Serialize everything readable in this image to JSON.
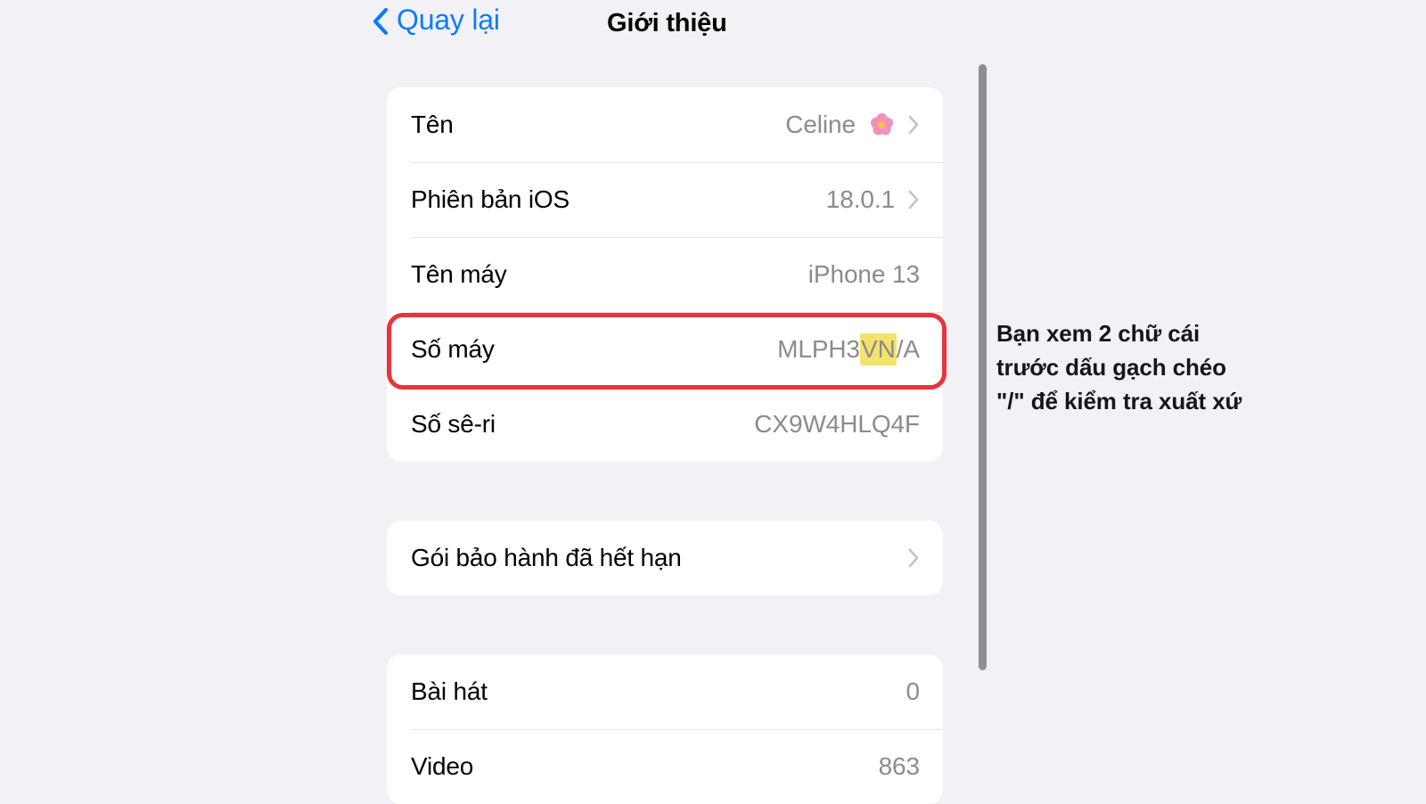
{
  "page": {
    "background_color": "#f2f1f6",
    "card_color": "#ffffff"
  },
  "navbar": {
    "back_label": "Quay lại",
    "back_icon": "chevron-left-icon",
    "back_color": "#0a7cff",
    "title": "Giới thiệu"
  },
  "sections": [
    {
      "id": "device-info",
      "rows": [
        {
          "label": "Tên",
          "value": "Celine",
          "emoji": "🌸",
          "emoji_name": "cherry-blossom-emoji",
          "chevron": true
        },
        {
          "label": "Phiên bản iOS",
          "value": "18.0.1",
          "chevron": true
        },
        {
          "label": "Tên máy",
          "value": "iPhone 13",
          "chevron": false
        },
        {
          "label": "Số máy",
          "value_prefix": "MLPH3",
          "value_highlight": "VN",
          "value_suffix": "/A",
          "value_full": "MLPH3VN/A",
          "highlight_color": "#f4e36a",
          "chevron": false,
          "annotated": true
        },
        {
          "label": "Số sê-ri",
          "value": "CX9W4HLQ4F",
          "chevron": false
        }
      ]
    },
    {
      "id": "warranty",
      "rows": [
        {
          "label": "Gói bảo hành đã hết hạn",
          "value": "",
          "chevron": true
        }
      ]
    },
    {
      "id": "media",
      "rows": [
        {
          "label": "Bài hát",
          "value": "0",
          "chevron": false
        },
        {
          "label": "Video",
          "value": "863",
          "chevron": false
        }
      ]
    }
  ],
  "highlight_box": {
    "color": "#e8343a",
    "target_row_label": "Số máy"
  },
  "scrollbar": {
    "color": "#8e8e93"
  },
  "annotation": {
    "line1": "Bạn xem 2 chữ cái",
    "line2": "trước dấu gạch chéo",
    "line3": "\"/\" để kiểm tra xuất xứ",
    "full_text": "Bạn xem 2 chữ cái trước dấu gạch chéo \"/\" để kiểm tra xuất xứ"
  }
}
